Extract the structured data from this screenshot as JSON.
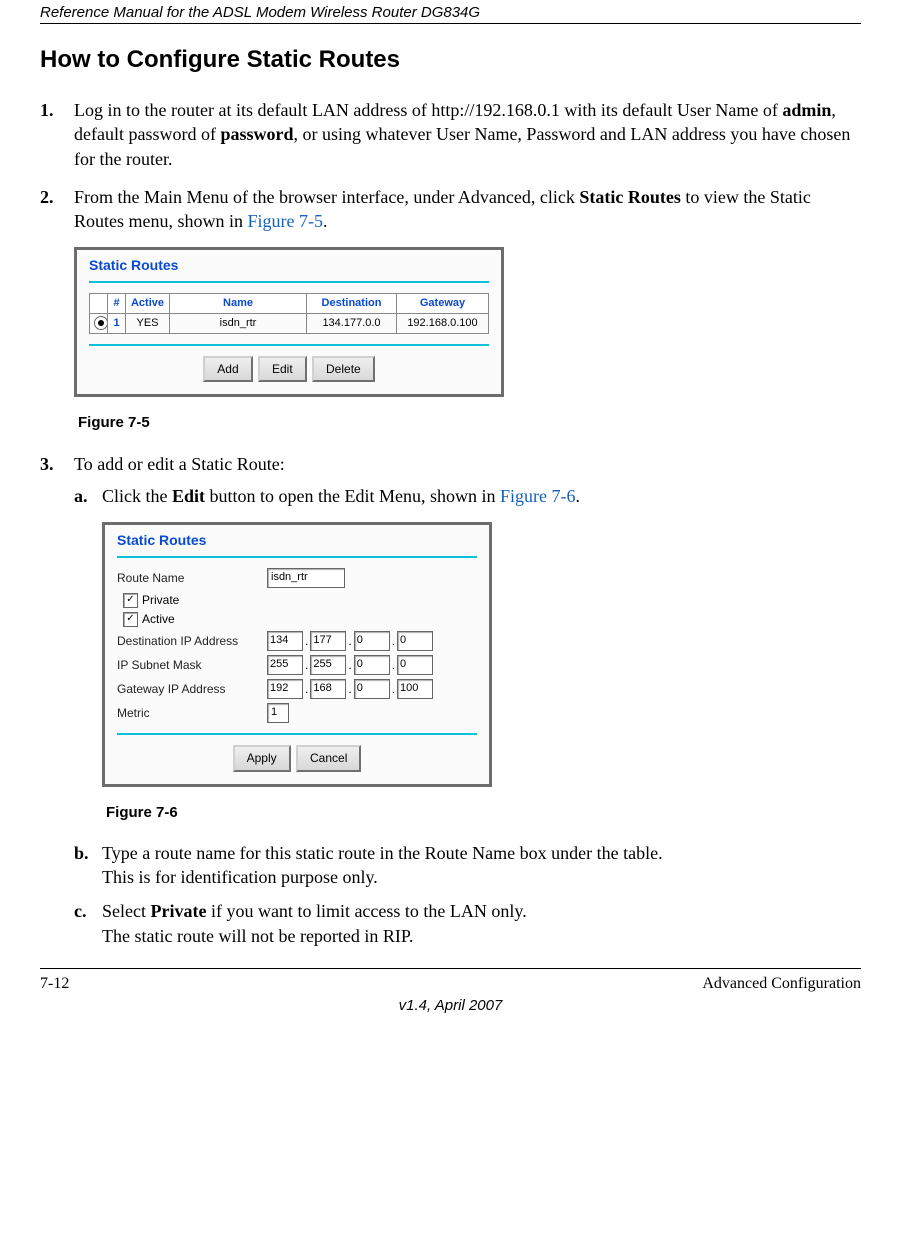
{
  "header": {
    "running_title": "Reference Manual for the ADSL Modem Wireless Router DG834G"
  },
  "section": {
    "title": "How to Configure Static Routes"
  },
  "steps": {
    "s1_a": "Log in to the router at its default LAN address of http://192.168.0.1 with its default User Name of ",
    "s1_admin": "admin",
    "s1_b": ", default password of ",
    "s1_password": "password",
    "s1_c": ", or using whatever User Name, Password and LAN address you have chosen for the router.",
    "s2_a": "From the Main Menu of the browser interface, under Advanced, click ",
    "s2_sr": "Static Routes",
    "s2_b": " to view the Static Routes menu, shown in ",
    "s2_fig": "Figure 7-5",
    "s2_c": ".",
    "s3": "To add or edit a Static Route:",
    "s3a_a": "Click the ",
    "s3a_edit": "Edit",
    "s3a_b": " button to open the Edit Menu, shown in ",
    "s3a_fig": "Figure 7-6",
    "s3a_c": ".",
    "s3b_a": "Type a route name for this static route in the Route Name box under the table.",
    "s3b_b": "This is for identification purpose only.",
    "s3c_a": "Select ",
    "s3c_priv": "Private",
    "s3c_b": " if you want to limit access to the LAN only.",
    "s3c_c": "The static route will not be reported in RIP."
  },
  "figure75": {
    "title": "Static Routes",
    "headers": {
      "num": "#",
      "active": "Active",
      "name": "Name",
      "destination": "Destination",
      "gateway": "Gateway"
    },
    "row": {
      "num": "1",
      "active": "YES",
      "name": "isdn_rtr",
      "destination": "134.177.0.0",
      "gateway": "192.168.0.100"
    },
    "buttons": {
      "add": "Add",
      "edit": "Edit",
      "delete": "Delete"
    },
    "caption": "Figure 7-5"
  },
  "figure76": {
    "title": "Static Routes",
    "labels": {
      "route_name": "Route Name",
      "private": "Private",
      "active": "Active",
      "dest_ip": "Destination IP Address",
      "subnet": "IP Subnet Mask",
      "gateway": "Gateway IP Address",
      "metric": "Metric"
    },
    "values": {
      "route_name": "isdn_rtr",
      "private_checked": "✓",
      "active_checked": "✓",
      "dest_ip": [
        "134",
        "177",
        "0",
        "0"
      ],
      "subnet": [
        "255",
        "255",
        "0",
        "0"
      ],
      "gateway": [
        "192",
        "168",
        "0",
        "100"
      ],
      "metric": "1"
    },
    "buttons": {
      "apply": "Apply",
      "cancel": "Cancel"
    },
    "caption": "Figure 7-6"
  },
  "footer": {
    "left": "7-12",
    "right": "Advanced Configuration",
    "center": "v1.4, April 2007"
  }
}
